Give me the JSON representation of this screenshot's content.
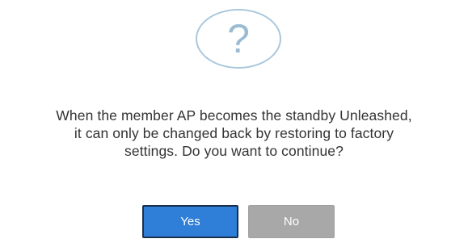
{
  "dialog": {
    "icon": "question-icon",
    "icon_glyph": "?",
    "message_lines": [
      "When the member AP becomes the standby Unleashed,",
      "it can only be changed back by restoring to factory",
      "settings. Do you want to continue?"
    ],
    "buttons": {
      "yes_label": "Yes",
      "no_label": "No"
    }
  },
  "colors": {
    "primary_button": "#2f7ed8",
    "secondary_button": "#a8a8a8",
    "icon": "#9bbbd3"
  }
}
